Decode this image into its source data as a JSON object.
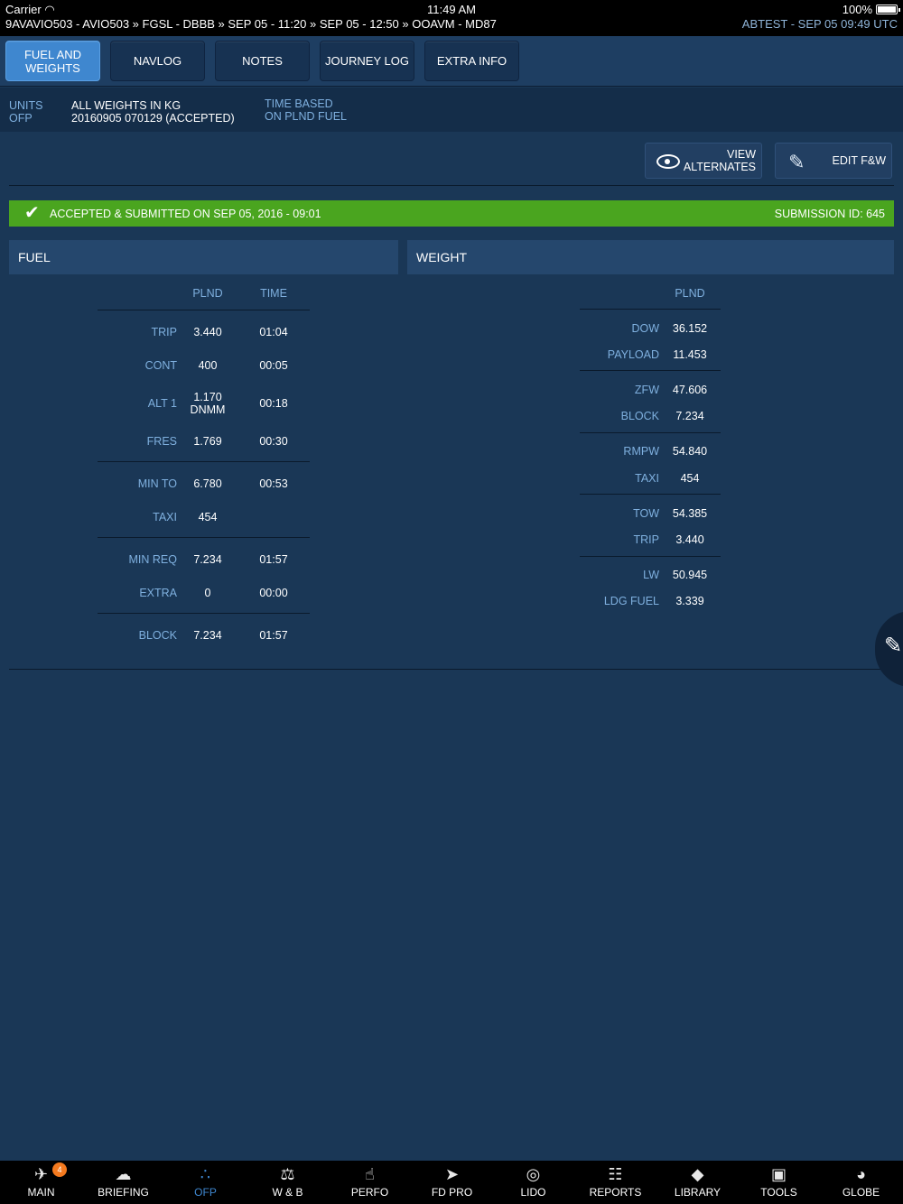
{
  "status_bar": {
    "carrier": "Carrier",
    "time": "11:49 AM",
    "battery": "100%",
    "route": "9AVAVIO503 - AVIO503 » FGSL - DBBB » SEP 05 - 11:20 » SEP 05 - 12:50 » OOAVM - MD87",
    "utc": "ABTEST - SEP 05 09:49 UTC"
  },
  "tabs": [
    {
      "label": "FUEL AND WEIGHTS"
    },
    {
      "label": "NAVLOG"
    },
    {
      "label": "NOTES"
    },
    {
      "label": "JOURNEY LOG"
    },
    {
      "label": "EXTRA INFO"
    }
  ],
  "info": {
    "units_label": "UNITS",
    "ofp_label": "OFP",
    "units_value": "ALL WEIGHTS IN KG",
    "ofp_value": "20160905 070129 (ACCEPTED)",
    "time_based_1": "TIME BASED",
    "time_based_2": "ON PLND FUEL"
  },
  "buttons": {
    "view_alt_1": "VIEW",
    "view_alt_2": "ALTERNATES",
    "edit_fw": "EDIT F&W"
  },
  "banner": {
    "message": "ACCEPTED & SUBMITTED ON SEP 05, 2016 - 09:01",
    "submission": "SUBMISSION ID: 645",
    "color": "#4aa51f"
  },
  "fuel": {
    "header": "FUEL",
    "col_plnd": "PLND",
    "col_time": "TIME",
    "rows": [
      {
        "label": "TRIP",
        "plnd": "3.440",
        "time": "01:04"
      },
      {
        "label": "CONT",
        "plnd": "400",
        "time": "00:05"
      },
      {
        "label": "ALT 1",
        "plnd": "1.170",
        "plnd2": "DNMM",
        "time": "00:18"
      },
      {
        "label": "FRES",
        "plnd": "1.769",
        "time": "00:30"
      },
      {
        "label": "MIN TO",
        "plnd": "6.780",
        "time": "00:53"
      },
      {
        "label": "TAXI",
        "plnd": "454",
        "time": ""
      },
      {
        "label": "MIN REQ",
        "plnd": "7.234",
        "time": "01:57"
      },
      {
        "label": "EXTRA",
        "plnd": "0",
        "time": "00:00"
      },
      {
        "label": "BLOCK",
        "plnd": "7.234",
        "time": "01:57"
      }
    ]
  },
  "weight": {
    "header": "WEIGHT",
    "col_plnd": "PLND",
    "rows": [
      {
        "label": "DOW",
        "plnd": "36.152"
      },
      {
        "label": "PAYLOAD",
        "plnd": "11.453"
      },
      {
        "label": "ZFW",
        "plnd": "47.606"
      },
      {
        "label": "BLOCK",
        "plnd": "7.234"
      },
      {
        "label": "RMPW",
        "plnd": "54.840"
      },
      {
        "label": "TAXI",
        "plnd": "454"
      },
      {
        "label": "TOW",
        "plnd": "54.385"
      },
      {
        "label": "TRIP",
        "plnd": "3.440"
      },
      {
        "label": "LW",
        "plnd": "50.945"
      },
      {
        "label": "LDG FUEL",
        "plnd": "3.339"
      }
    ]
  },
  "bottom_nav": [
    {
      "label": "MAIN",
      "icon": "airplane-icon",
      "badge": "4"
    },
    {
      "label": "BRIEFING",
      "icon": "cloud-icon"
    },
    {
      "label": "OFP",
      "icon": "route-icon"
    },
    {
      "label": "W & B",
      "icon": "scale-icon"
    },
    {
      "label": "PERFO",
      "icon": "thumbs-up-icon"
    },
    {
      "label": "FD PRO",
      "icon": "navigation-arrow-icon"
    },
    {
      "label": "LIDO",
      "icon": "lido-icon"
    },
    {
      "label": "REPORTS",
      "icon": "clipboard-icon"
    },
    {
      "label": "LIBRARY",
      "icon": "book-icon"
    },
    {
      "label": "TOOLS",
      "icon": "toolbox-icon"
    },
    {
      "label": "GLOBE",
      "icon": "globe-icon"
    }
  ]
}
